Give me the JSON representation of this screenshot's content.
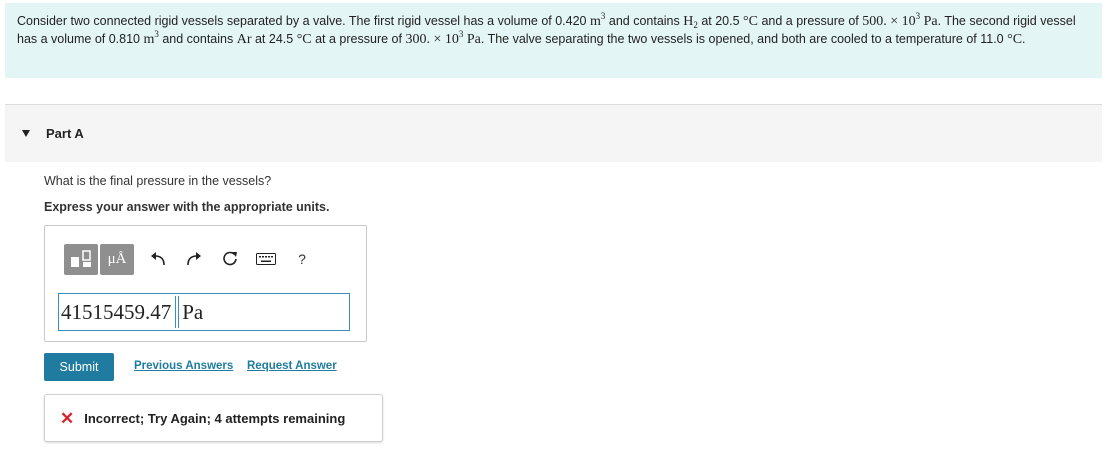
{
  "problem": {
    "t1": "Consider two connected rigid vessels separated by a valve. The first rigid vessel has a volume of 0.420 ",
    "m3a": "m",
    "exp3a": "3",
    "t2": " and contains ",
    "h": "H",
    "h_sub": "2",
    "t3": " at 20.5 ",
    "deg1": "°C",
    "t4": " and a pressure of ",
    "p1": "500. × 10",
    "p1_exp": "3",
    "pa1": " Pa",
    "t5": ". The second rigid vessel has a volume of 0.810 ",
    "m3b": "m",
    "exp3b": "3",
    "t6": " and contains ",
    "ar": "Ar",
    "t7": " at 24.5 ",
    "deg2": "°C",
    "t8": " at a pressure of ",
    "p2": "300. × 10",
    "p2_exp": "3",
    "pa2": " Pa",
    "t9": ". The valve separating the two vessels is opened, and both are cooled to a temperature of 11.0 ",
    "deg3": "°C",
    "t10": "."
  },
  "part": {
    "title": "Part A"
  },
  "question": "What is the final pressure in the vessels?",
  "instruction": "Express your answer with the appropriate units.",
  "toolbar": {
    "templates_icon": "templates-icon",
    "units_label": "μÅ",
    "undo_icon": "undo-icon",
    "redo_icon": "redo-icon",
    "reset_icon": "reset-icon",
    "keyboard_icon": "keyboard-icon",
    "help_label": "?"
  },
  "answer": {
    "value": "41515459.47",
    "unit": "Pa"
  },
  "actions": {
    "submit": "Submit",
    "previous_answers": "Previous Answers",
    "request_answer": "Request Answer"
  },
  "feedback": {
    "icon": "x-icon",
    "text": "Incorrect; Try Again; 4 attempts remaining",
    "color": "#d9262e"
  },
  "colors": {
    "problem_bg": "#e4f5f5",
    "accent": "#1f7ca0",
    "input_border": "#3a8fbf"
  }
}
